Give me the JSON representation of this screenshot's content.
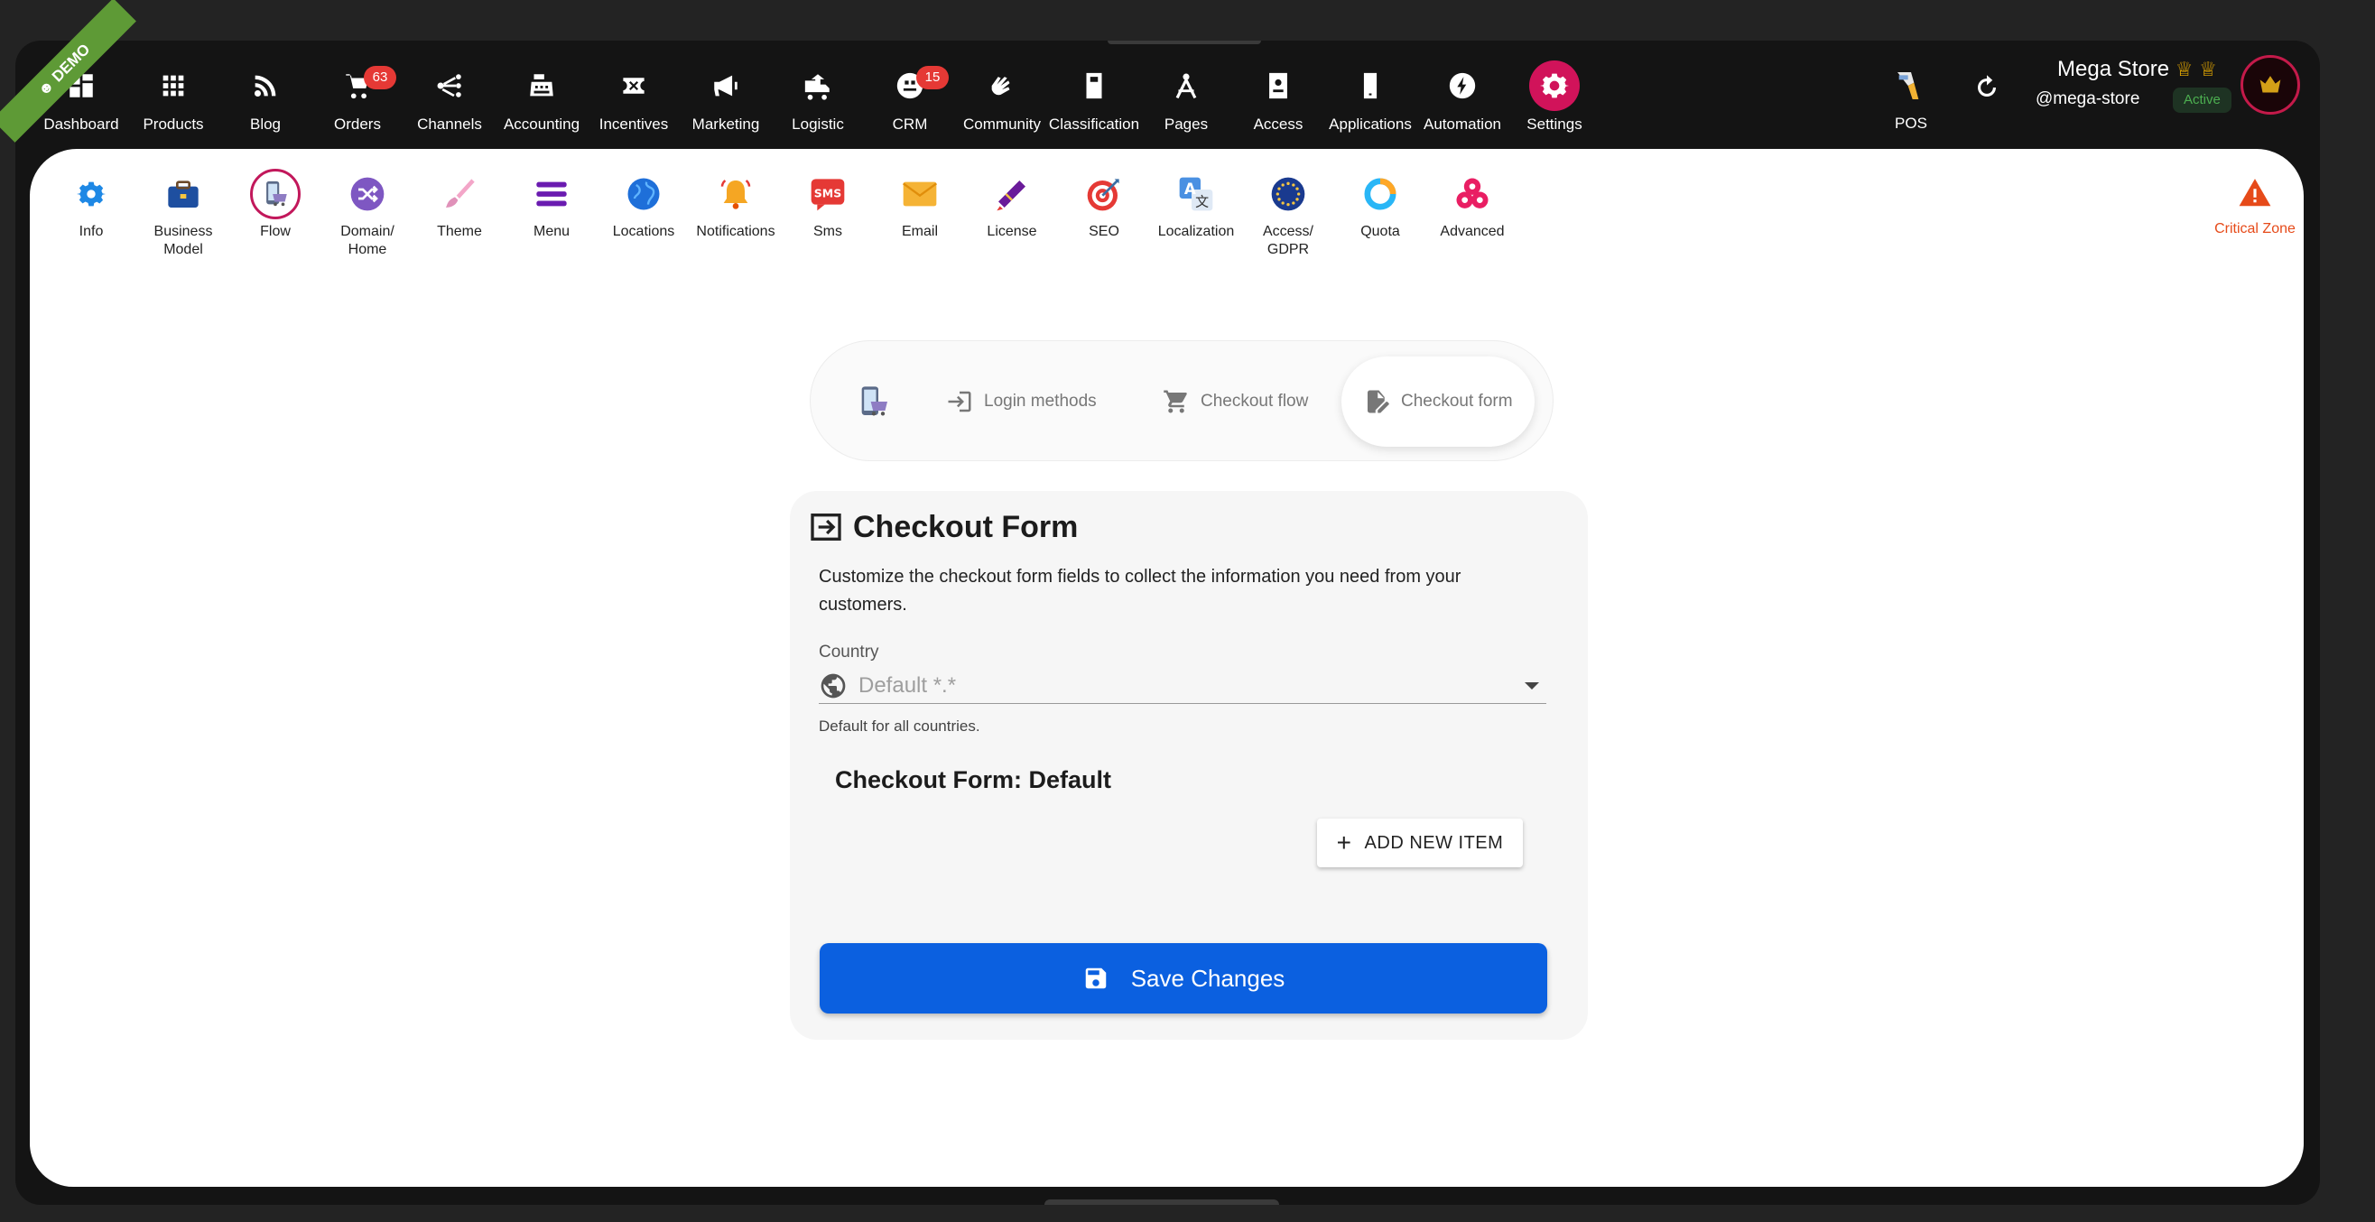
{
  "demo_ribbon": "DEMO",
  "topnav": [
    {
      "label": "Dashboard",
      "icon": "dashboard-icon"
    },
    {
      "label": "Products",
      "icon": "grid-icon"
    },
    {
      "label": "Blog",
      "icon": "rss-icon"
    },
    {
      "label": "Orders",
      "icon": "cart-icon",
      "badge": "63"
    },
    {
      "label": "Channels",
      "icon": "channels-icon"
    },
    {
      "label": "Accounting",
      "icon": "cash-register-icon"
    },
    {
      "label": "Incentives",
      "icon": "ticket-icon"
    },
    {
      "label": "Marketing",
      "icon": "megaphone-icon"
    },
    {
      "label": "Logistic",
      "icon": "truck-icon"
    },
    {
      "label": "CRM",
      "icon": "crm-icon",
      "badge": "15"
    },
    {
      "label": "Community",
      "icon": "hands-icon"
    },
    {
      "label": "Classification",
      "icon": "book-icon"
    },
    {
      "label": "Pages",
      "icon": "compass-icon"
    },
    {
      "label": "Access",
      "icon": "badge-icon"
    },
    {
      "label": "Applications",
      "icon": "phone-icon"
    },
    {
      "label": "Automation",
      "icon": "bolt-icon"
    },
    {
      "label": "Settings",
      "icon": "gear-icon",
      "active": true
    }
  ],
  "pos": {
    "label": "POS"
  },
  "store": {
    "name": "Mega Store",
    "handle": "@mega-store",
    "status": "Active"
  },
  "subnav": [
    {
      "label": "Info",
      "icon": "gear-icon"
    },
    {
      "label": "Business\nModel",
      "icon": "briefcase-icon"
    },
    {
      "label": "Flow",
      "icon": "phone-cart-icon",
      "active": true
    },
    {
      "label": "Domain/\nHome",
      "icon": "shuffle-icon"
    },
    {
      "label": "Theme",
      "icon": "brush-icon"
    },
    {
      "label": "Menu",
      "icon": "menu-icon"
    },
    {
      "label": "Locations",
      "icon": "globe-icon"
    },
    {
      "label": "Notifications",
      "icon": "bell-icon"
    },
    {
      "label": "Sms",
      "icon": "sms-icon"
    },
    {
      "label": "Email",
      "icon": "envelope-icon"
    },
    {
      "label": "License",
      "icon": "diploma-icon"
    },
    {
      "label": "SEO",
      "icon": "target-icon"
    },
    {
      "label": "Localization",
      "icon": "translate-icon"
    },
    {
      "label": "Access/\nGDPR",
      "icon": "eu-flag-icon"
    },
    {
      "label": "Quota",
      "icon": "ring-icon"
    },
    {
      "label": "Advanced",
      "icon": "gears-icon"
    }
  ],
  "critical_zone": "Critical Zone",
  "flow_tabs": [
    {
      "label": "",
      "icon": "phone-cart-icon"
    },
    {
      "label": "Login methods",
      "icon": "login-icon"
    },
    {
      "label": "Checkout flow",
      "icon": "cart-icon"
    },
    {
      "label": "Checkout form",
      "icon": "form-edit-icon",
      "selected": true
    }
  ],
  "form": {
    "title": "Checkout Form",
    "description": "Customize the checkout form fields to collect the information you need from your customers.",
    "country_label": "Country",
    "country_placeholder": "Default *.*",
    "country_helper": "Default for all countries.",
    "subtitle": "Checkout Form: Default",
    "add_button": "ADD NEW ITEM",
    "save_button": "Save Changes"
  }
}
